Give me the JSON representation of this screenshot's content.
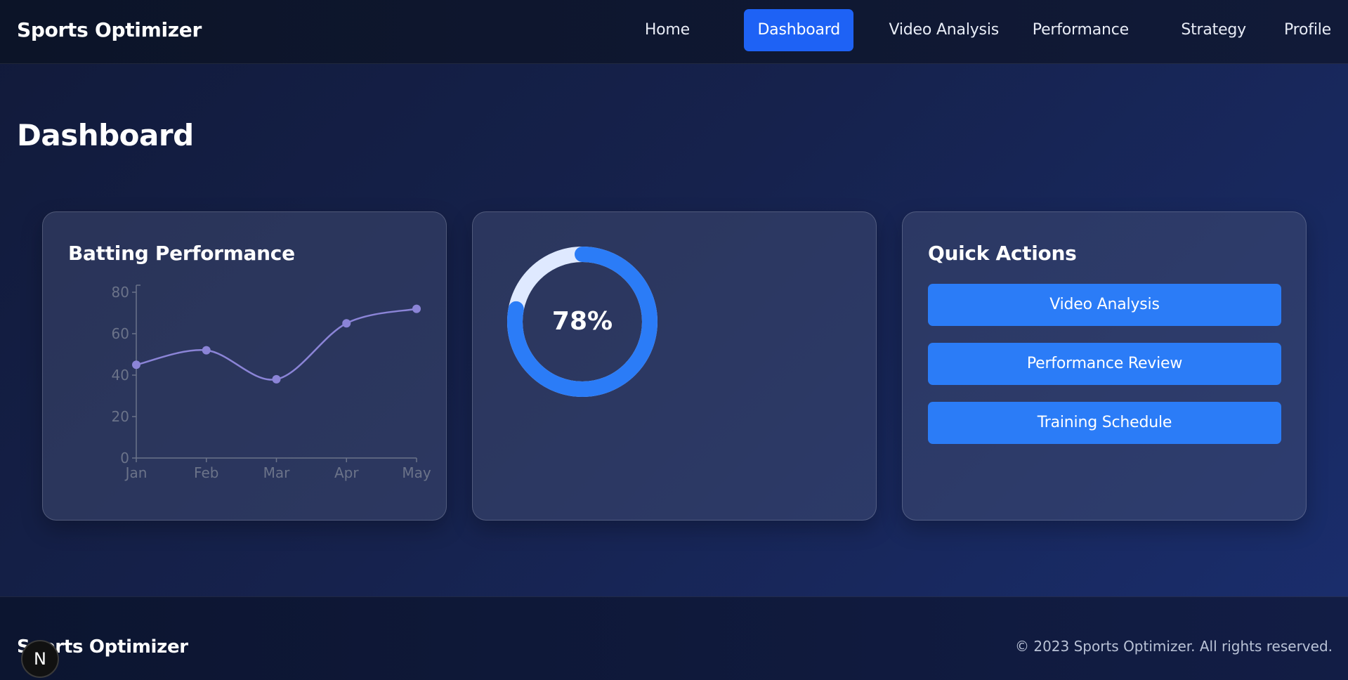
{
  "app": {
    "title": "Sports Optimizer"
  },
  "nav": {
    "items": [
      {
        "label": "Home",
        "active": false
      },
      {
        "label": "Dashboard",
        "active": true
      },
      {
        "label": "Video Analysis",
        "active": false
      },
      {
        "label": "Performance",
        "active": false
      },
      {
        "label": "Strategy",
        "active": false
      },
      {
        "label": "Profile",
        "active": false
      }
    ]
  },
  "page": {
    "title": "Dashboard"
  },
  "batting_card": {
    "title": "Batting Performance"
  },
  "chart_data": {
    "type": "line",
    "title": "Batting Performance",
    "categories": [
      "Jan",
      "Feb",
      "Mar",
      "Apr",
      "May"
    ],
    "series": [
      {
        "values": [
          45,
          52,
          38,
          65,
          72
        ]
      }
    ],
    "yticks": [
      0,
      20,
      40,
      60,
      80
    ],
    "ylim": [
      0,
      80
    ],
    "line_color": "#8b84d7",
    "axis_color": "#6b7389",
    "grid": false
  },
  "progress_card": {
    "value_label": "78%",
    "value": 0.78,
    "track_color": "#dfe9ff",
    "fill_color": "#2b7cf7"
  },
  "quick_actions": {
    "title": "Quick Actions",
    "buttons": [
      {
        "label": "Video Analysis"
      },
      {
        "label": "Performance Review"
      },
      {
        "label": "Training Schedule"
      }
    ]
  },
  "footer": {
    "brand": "Sports Optimizer",
    "copyright": "© 2023 Sports Optimizer. All rights reserved."
  },
  "dev_badge": {
    "letter": "N"
  },
  "colors": {
    "accent": "#1e62f5",
    "button": "#2b7cf7"
  }
}
